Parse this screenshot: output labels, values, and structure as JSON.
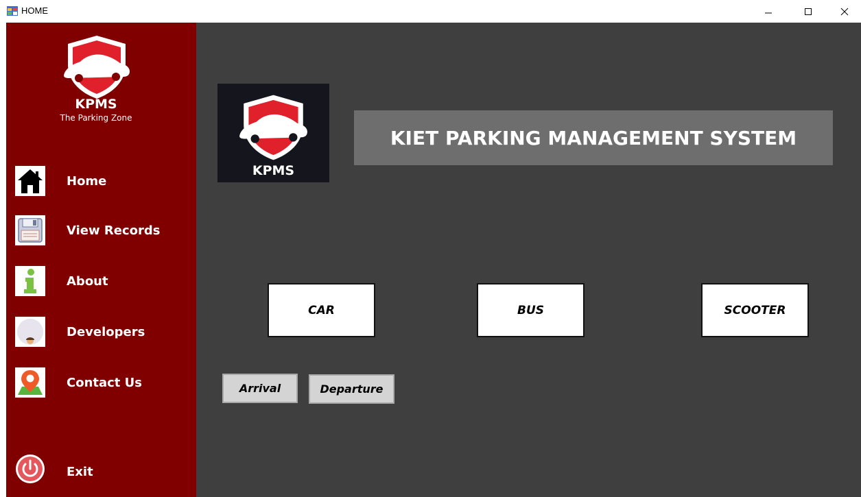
{
  "window": {
    "title": "HOME",
    "icon": "app-window-icon",
    "controls": [
      "minimize-icon",
      "maximize-icon",
      "close-icon"
    ]
  },
  "colors": {
    "sidebar": "#800000",
    "main": "#3f3f3f",
    "title_bar_panel": "#6e6e6e",
    "logo_bg": "#15151d",
    "shield_red": "#e0202a"
  },
  "sidebar": {
    "brand": {
      "name": "KPMS",
      "tagline": "The Parking Zone"
    },
    "items": [
      {
        "label": "Home",
        "icon": "home-icon"
      },
      {
        "label": "View Records",
        "icon": "floppy-disk-icon"
      },
      {
        "label": "About",
        "icon": "info-icon"
      },
      {
        "label": "Developers",
        "icon": "avatar-icon"
      },
      {
        "label": "Contact Us",
        "icon": "map-pin-icon"
      }
    ],
    "exit": {
      "label": "Exit",
      "icon": "power-icon"
    }
  },
  "main": {
    "logo_text": "KPMS",
    "system_title": "KIET PARKING MANAGEMENT SYSTEM",
    "vehicles": [
      {
        "label": "CAR"
      },
      {
        "label": "BUS"
      },
      {
        "label": "SCOOTER"
      }
    ],
    "actions": {
      "arrival": "Arrival",
      "departure": "Departure"
    }
  }
}
